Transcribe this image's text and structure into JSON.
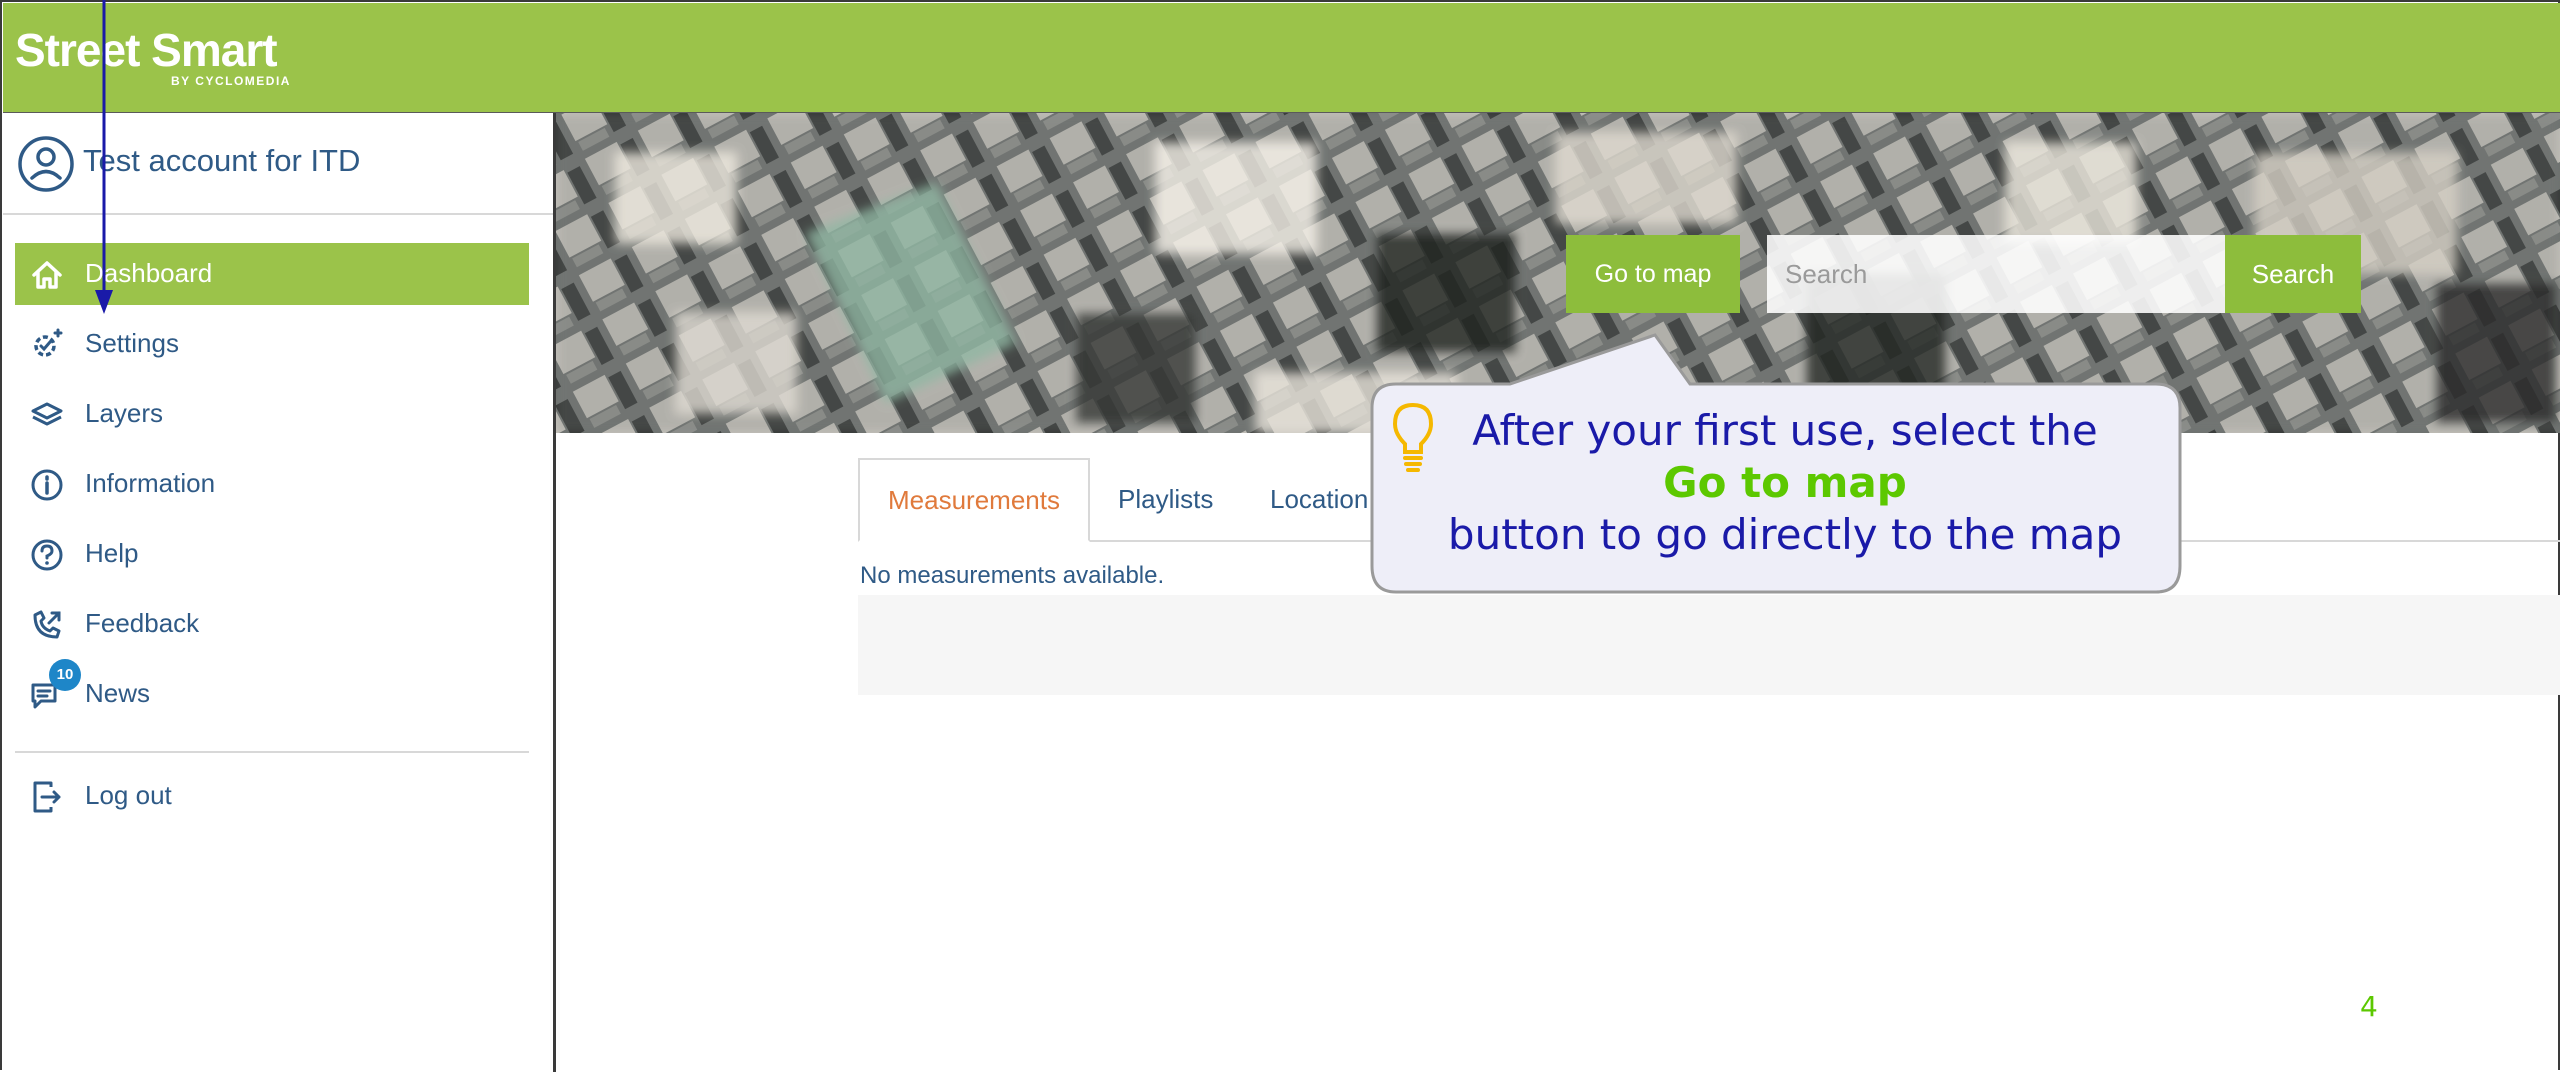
{
  "colors": {
    "brand_green": "#9bc34a",
    "button_green": "#8dbd3c",
    "link_blue": "#2f5a86",
    "active_tab": "#e07a3c",
    "callout_text": "#1a1aa8",
    "callout_highlight": "#5cc800",
    "badge_blue": "#1e86c8"
  },
  "header": {
    "logo_main": "Street Smart",
    "logo_sub": "BY CYCLOMEDIA"
  },
  "sidebar": {
    "account": {
      "icon": "user-circle-icon",
      "name": "Test account for ITD"
    },
    "items": [
      {
        "label": "Dashboard",
        "icon": "home-icon",
        "active": true
      },
      {
        "label": "Settings",
        "icon": "gear-check-icon",
        "active": false
      },
      {
        "label": "Layers",
        "icon": "layers-icon",
        "active": false
      },
      {
        "label": "Information",
        "icon": "info-circle-icon",
        "active": false
      },
      {
        "label": "Help",
        "icon": "question-circle-icon",
        "active": false
      },
      {
        "label": "Feedback",
        "icon": "phone-feedback-icon",
        "active": false
      },
      {
        "label": "News",
        "icon": "chat-icon",
        "active": false,
        "badge": "10"
      }
    ],
    "logout": {
      "label": "Log out",
      "icon": "logout-icon"
    }
  },
  "hero": {
    "goto_map_label": "Go to map",
    "search_placeholder": "Search",
    "search_button_label": "Search"
  },
  "tabs": [
    {
      "label": "Measurements",
      "active": true
    },
    {
      "label": "Playlists",
      "active": false
    },
    {
      "label": "Location",
      "active": false
    }
  ],
  "content": {
    "empty_message": "No measurements available."
  },
  "callout": {
    "line1": "After your first use, select the",
    "line2": "Go to map",
    "line3": "button to go directly to the map",
    "icon": "lightbulb-icon"
  },
  "page_number": "4"
}
